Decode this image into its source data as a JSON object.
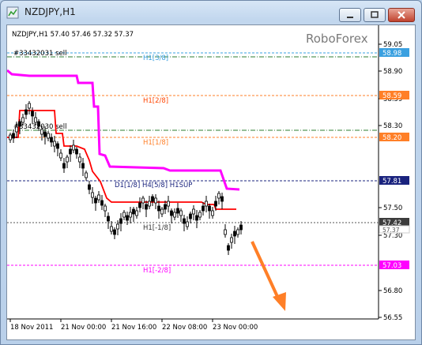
{
  "window": {
    "title": "NZDJPY,H1"
  },
  "chart": {
    "header": "NZDJPY,H1  57.40 57.46 57.32 57.37",
    "watermark": "RoboForex",
    "order_label_1": "#33432031 sell",
    "order_label_2": "#33432030 sell",
    "level_labels": {
      "h1_3_8": "H1[3/8]",
      "h1_2_8": "H1[2/8]",
      "h1_1_8": "H1[1/8]",
      "d1_h4_h1": "D1[1/8] H4[5/8] H1SUP",
      "h1_m1_8": "H1[-1/8]",
      "h1_m2_8": "H1[-2/8]"
    },
    "y_ticks": [
      "59.05",
      "58.90",
      "58.59",
      "58.30",
      "57.81",
      "57.50",
      "57.42",
      "57.37",
      "57.30",
      "57.03",
      "56.80",
      "56.55"
    ],
    "price_tags": {
      "p5898": "58.98",
      "p5859": "58.59",
      "p5820": "58.20",
      "p5781": "57.81",
      "p5742": "57.42",
      "p5737": "57.37",
      "p5703": "57.03"
    },
    "x_ticks": [
      "18 Nov 2011",
      "21 Nov 00:00",
      "21 Nov 16:00",
      "22 Nov 08:00",
      "23 Nov 00:00"
    ],
    "colors": {
      "magenta": "#ff00ff",
      "red": "#ff0000",
      "orange": "#ff7f27",
      "blue_tag": "#3aa0e0",
      "green": "#2e7d32",
      "navy": "#1a237e"
    }
  }
}
